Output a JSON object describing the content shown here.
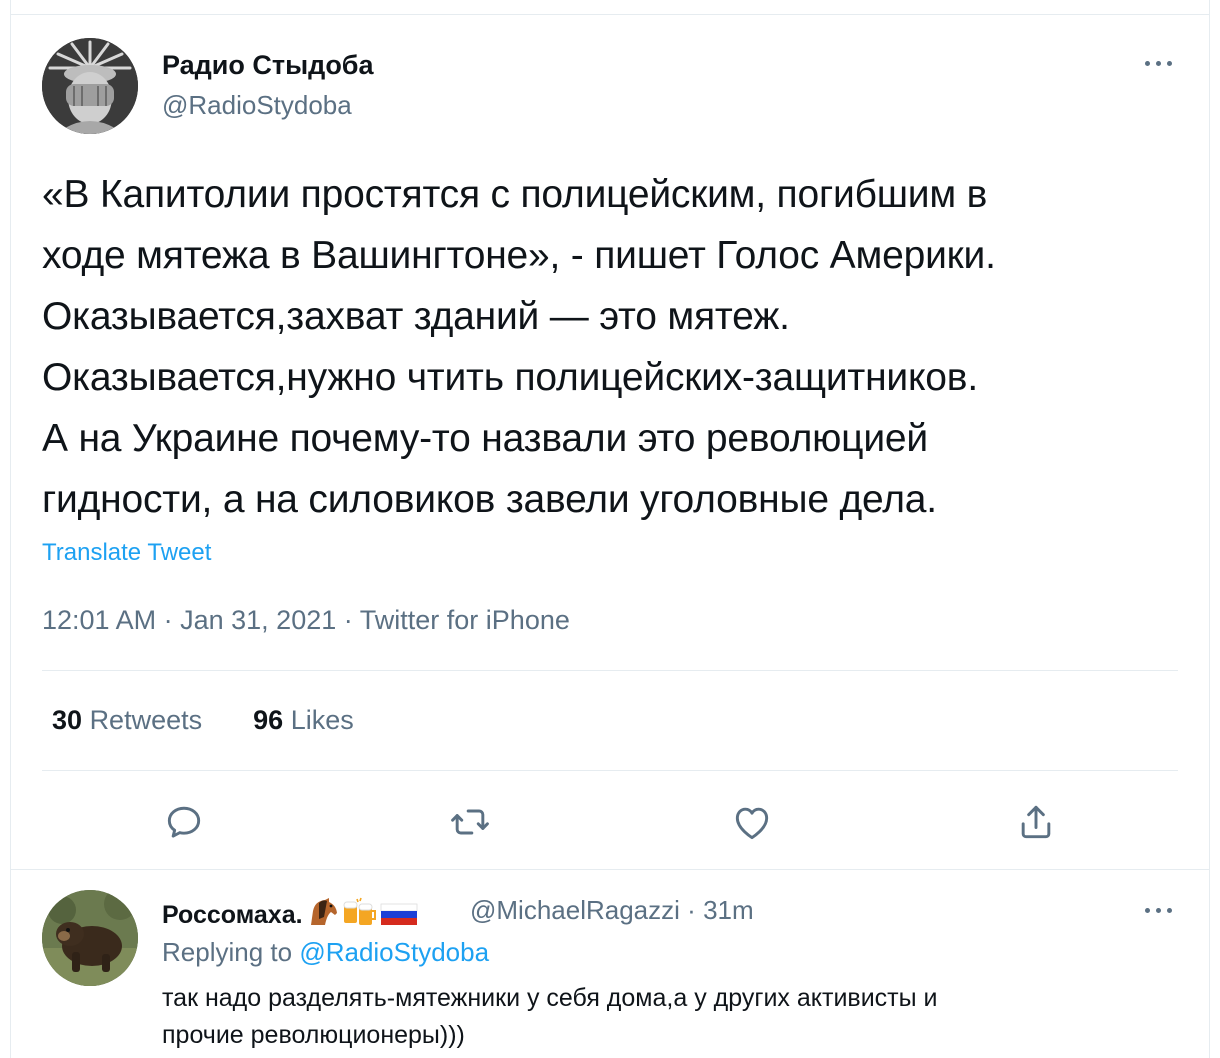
{
  "tweet": {
    "author_name": "Радио Стыдоба",
    "author_handle": "@RadioStydoba",
    "text_lines": [
      "«В Капитолии простятся с полицейским, погибшим в",
      "ходе мятежа в Вашингтоне», - пишет Голос Америки.",
      "Оказывается,захват зданий — это мятеж.",
      "Оказывается,нужно чтить полицейских-защитников.",
      "А на Украине почему-то назвали это революцией",
      "гидности, а на силовиков завели уголовные дела."
    ],
    "translate_label": "Translate Tweet",
    "time": "12:01 AM",
    "date": "Jan 31, 2021",
    "source": "Twitter for iPhone",
    "separator": "·",
    "retweets_count": "30",
    "retweets_label": "Retweets",
    "likes_count": "96",
    "likes_label": "Likes"
  },
  "actions": {
    "reply_icon": "reply-icon",
    "retweet_icon": "retweet-icon",
    "like_icon": "heart-icon",
    "share_icon": "share-icon"
  },
  "reply": {
    "author_name": "Россомаха.",
    "author_emojis": [
      "horse",
      "beer-mugs",
      "russia-flag"
    ],
    "author_handle": "@MichaelRagazzi",
    "separator": "·",
    "time_ago": "31m",
    "replying_to_label": "Replying to",
    "replying_to_handle": "@RadioStydoba",
    "text_lines": [
      "так надо разделять-мятежники у себя дома,а у других активисты и",
      "прочие революционеры)))"
    ]
  },
  "colors": {
    "accent": "#1da1f2",
    "secondary_text": "#5b7083",
    "primary_text": "#0f1419",
    "divider": "#e6ecf0"
  }
}
